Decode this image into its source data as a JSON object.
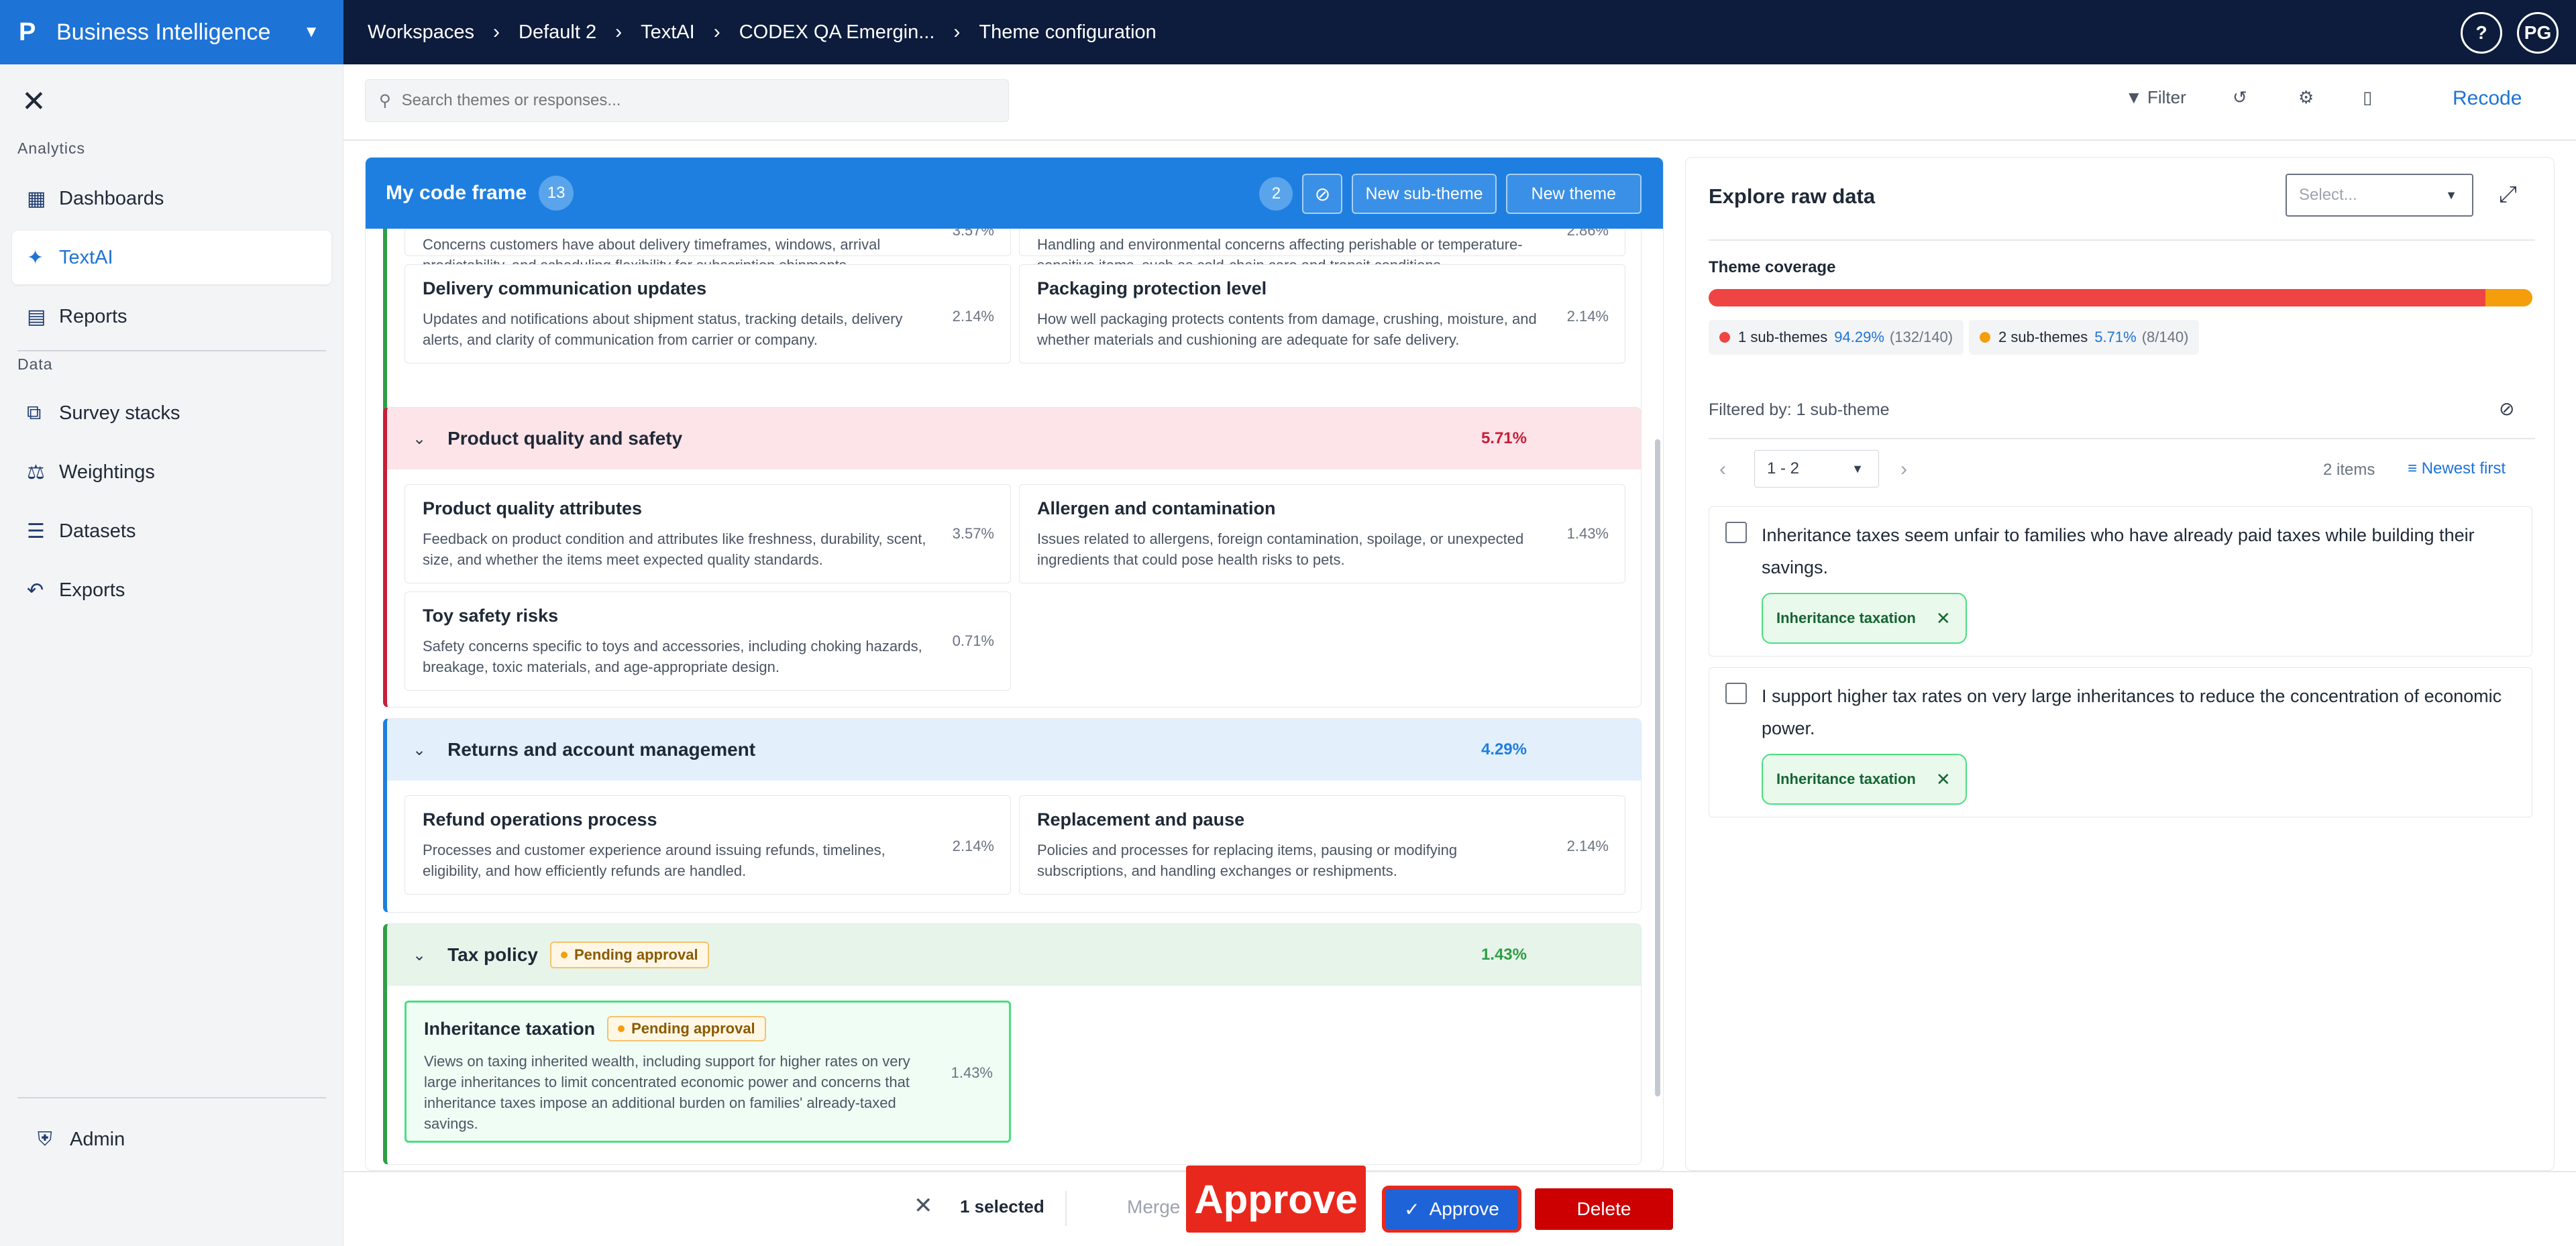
{
  "topbar": {
    "logo": "P",
    "brand": "Business Intelligence",
    "breadcrumb": [
      "Workspaces",
      "Default 2",
      "TextAI",
      "CODEX QA Emergin...",
      "Theme configuration"
    ],
    "help": "?",
    "user_initials": "PG"
  },
  "sidebar": {
    "analytics_label": "Analytics",
    "data_label": "Data",
    "items": [
      {
        "label": "Dashboards",
        "icon": "dashboard-icon"
      },
      {
        "label": "TextAI",
        "icon": "sparkle-icon",
        "active": true
      },
      {
        "label": "Reports",
        "icon": "document-icon"
      },
      {
        "label": "Survey stacks",
        "icon": "stack-icon"
      },
      {
        "label": "Weightings",
        "icon": "scale-icon"
      },
      {
        "label": "Datasets",
        "icon": "list-icon"
      },
      {
        "label": "Exports",
        "icon": "export-icon"
      }
    ],
    "admin": "Admin"
  },
  "search": {
    "placeholder": "Search themes or responses..."
  },
  "toolbar": {
    "filter": "Filter",
    "recode": "Recode"
  },
  "codeframe": {
    "title": "My code frame",
    "count": "13",
    "selected_count": "2",
    "new_sub_theme": "New sub-theme",
    "new_theme": "New theme",
    "top_cards": [
      {
        "desc": "Concerns customers have about delivery timeframes, windows, arrival predictability, and scheduling flexibility for subscription shipments.",
        "pct": "3.57%"
      },
      {
        "desc": "Handling and environmental concerns affecting perishable or temperature-sensitive items, such as cold-chain care and transit conditions.",
        "pct": "2.86%"
      },
      {
        "title": "Delivery communication updates",
        "desc": "Updates and notifications about shipment status, tracking details, delivery alerts, and clarity of communication from carrier or company.",
        "pct": "2.14%"
      },
      {
        "title": "Packaging protection level",
        "desc": "How well packaging protects contents from damage, crushing, moisture, and whether materials and cushioning are adequate for safe delivery.",
        "pct": "2.14%"
      }
    ],
    "groups": [
      {
        "name": "Product quality and safety",
        "pct": "5.71%",
        "color": "#c81e3a",
        "bg": "#fde4e8",
        "cards": [
          {
            "title": "Product quality attributes",
            "desc": "Feedback on product condition and attributes like freshness, durability, scent, size, and whether the items meet expected quality standards.",
            "pct": "3.57%"
          },
          {
            "title": "Allergen and contamination",
            "desc": "Issues related to allergens, foreign contamination, spoilage, or unexpected ingredients that could pose health risks to pets.",
            "pct": "1.43%"
          },
          {
            "title": "Toy safety risks",
            "desc": "Safety concerns specific to toys and accessories, including choking hazards, breakage, toxic materials, and age-appropriate design.",
            "pct": "0.71%"
          }
        ]
      },
      {
        "name": "Returns and account management",
        "pct": "4.29%",
        "color": "#1e7fe0",
        "bg": "#e3f0fc",
        "cards": [
          {
            "title": "Refund operations process",
            "desc": "Processes and customer experience around issuing refunds, timelines, eligibility, and how efficiently refunds are handled.",
            "pct": "2.14%"
          },
          {
            "title": "Replacement and pause",
            "desc": "Policies and processes for replacing items, pausing or modifying subscriptions, and handling exchanges or reshipments.",
            "pct": "2.14%"
          }
        ]
      },
      {
        "name": "Tax policy",
        "pct": "1.43%",
        "color": "#2f9e44",
        "bg": "#e6f4ea",
        "pending": "Pending approval",
        "cards": [
          {
            "title": "Inheritance taxation",
            "pending": "Pending approval",
            "desc": "Views on taxing inherited wealth, including support for higher rates on very large inheritances to limit concentrated economic power and concerns that inheritance taxes impose an additional burden on families' already-taxed savings.",
            "pct": "1.43%"
          }
        ]
      }
    ]
  },
  "raw": {
    "title": "Explore raw data",
    "select_placeholder": "Select...",
    "coverage_label": "Theme coverage",
    "coverage": [
      {
        "label": "1 sub-themes",
        "pct": "94.29%",
        "frac": "(132/140)",
        "value": 94.29,
        "color": "#ef4444"
      },
      {
        "label": "2 sub-themes",
        "pct": "5.71%",
        "frac": "(8/140)",
        "value": 5.71,
        "color": "#f59e0b"
      }
    ],
    "filtered_by": "Filtered by: 1 sub-theme",
    "page": "1 - 2",
    "items": "2 items",
    "sort": "Newest first",
    "responses": [
      {
        "text": "Inheritance taxes seem unfair to families who have already paid taxes while building their savings.",
        "tag": "Inheritance taxation"
      },
      {
        "text": "I support higher tax rates on very large inheritances to reduce the concentration of economic power.",
        "tag": "Inheritance taxation"
      }
    ]
  },
  "bottom": {
    "selected": "1 selected",
    "merge": "Merge",
    "approve_callout": "Approve",
    "approve": "Approve",
    "delete": "Delete"
  }
}
